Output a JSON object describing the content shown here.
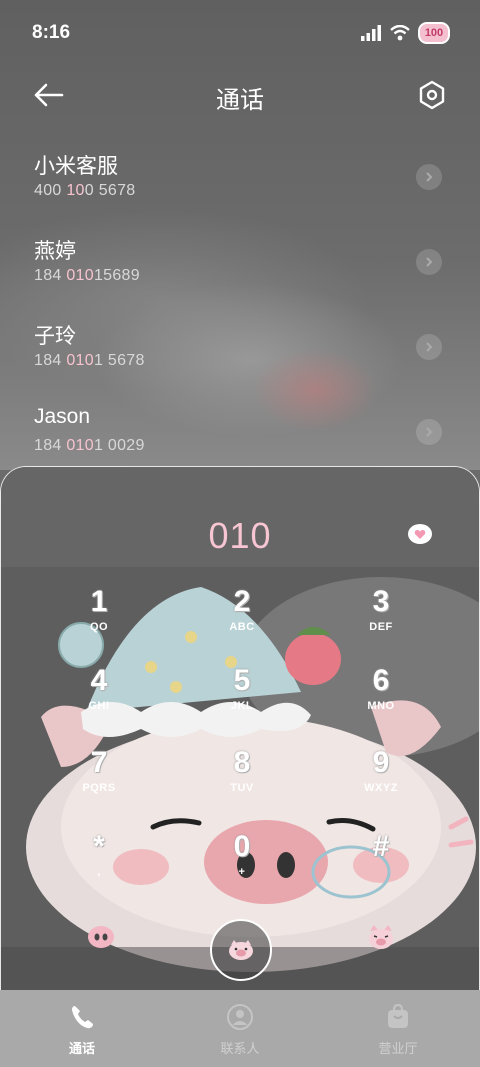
{
  "status": {
    "time": "8:16",
    "battery": "100"
  },
  "header": {
    "title": "通话"
  },
  "contacts": [
    {
      "name": "小米客服",
      "num_pre": "400 ",
      "num_hl": "10",
      "num_post": "0 5678"
    },
    {
      "name": "燕婷",
      "num_pre": "184 ",
      "num_hl": "010",
      "num_post": "15689"
    },
    {
      "name": "子玲",
      "num_pre": "184 ",
      "num_hl": "010",
      "num_post": "1 5678"
    },
    {
      "name": "Jason",
      "num_pre": "184 ",
      "num_hl": "010",
      "num_post": "1 0029"
    }
  ],
  "dialer": {
    "input": "010",
    "keys": [
      {
        "digit": "1",
        "letters": "QO"
      },
      {
        "digit": "2",
        "letters": "ABC"
      },
      {
        "digit": "3",
        "letters": "DEF"
      },
      {
        "digit": "4",
        "letters": "GHI"
      },
      {
        "digit": "5",
        "letters": "JKL"
      },
      {
        "digit": "6",
        "letters": "MNO"
      },
      {
        "digit": "7",
        "letters": "PQRS"
      },
      {
        "digit": "8",
        "letters": "TUV"
      },
      {
        "digit": "9",
        "letters": "WXYZ"
      },
      {
        "digit": "*",
        "letters": ","
      },
      {
        "digit": "0",
        "letters": "+"
      },
      {
        "digit": "#",
        "letters": ""
      }
    ]
  },
  "nav": {
    "calls": "通话",
    "contacts": "联系人",
    "hall": "营业厅"
  },
  "colors": {
    "accent_pink": "#f7c6d2",
    "nav_bg": "#a9a9a9"
  }
}
